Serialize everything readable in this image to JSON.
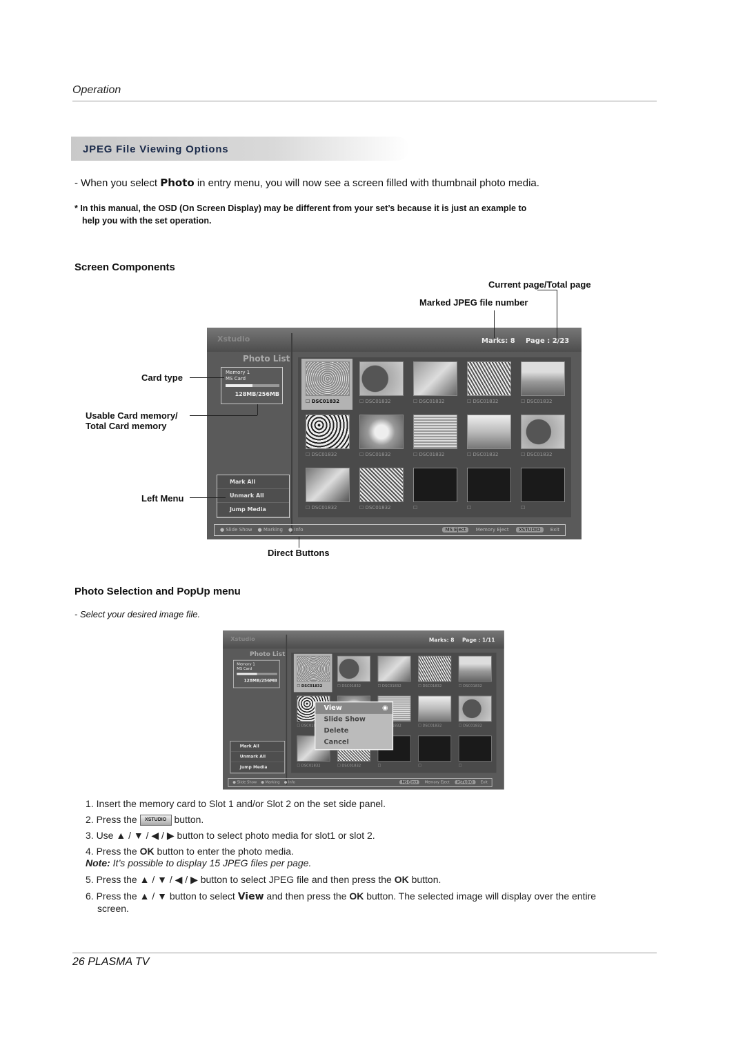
{
  "header": {
    "section": "Operation"
  },
  "section_title": "JPEG File Viewing Options",
  "intro": {
    "prefix": "- When you select ",
    "bold": "Photo",
    "suffix": " in entry menu, you will now see a screen filled with thumbnail photo media."
  },
  "note_line1": "* In this manual, the OSD (On Screen Display) may be different from your set’s because it is just an example to",
  "note_line2": "help you with the set operation.",
  "screen_components": {
    "title": "Screen Components",
    "callouts": {
      "current_page": "Current page/Total page",
      "marked": "Marked JPEG file number",
      "card_type": "Card type",
      "usable1": "Usable Card memory/",
      "usable2": "Total Card memory",
      "left_menu": "Left Menu",
      "direct": "Direct Buttons"
    }
  },
  "screen1": {
    "title": "Xstudio",
    "marks": "Marks: 8",
    "page": "Page : 2/23",
    "photo_list": "Photo List",
    "memory": "Memory 1",
    "card": "MS Card",
    "size": "128MB/256MB",
    "memory_used": 0.5,
    "left_menu": [
      "Mark All",
      "Unmark All",
      "Jump Media"
    ],
    "files": [
      "DSC01832",
      "DSC01832",
      "DSC01832",
      "DSC01832",
      "DSC01832",
      "DSC01832",
      "DSC01832",
      "DSC01832",
      "DSC01832",
      "DSC01832",
      "DSC01832",
      "DSC01832",
      "",
      "",
      ""
    ],
    "bottom": {
      "slide": "Slide Show",
      "marking": "Marking",
      "info": "Info",
      "eject_key": "MS Eject",
      "eject": "Memory Eject",
      "exit_key": "XSTUDIO",
      "exit": "Exit"
    }
  },
  "screen2": {
    "marks": "Marks: 8",
    "page": "Page : 1/11",
    "popup": [
      "View",
      "Slide Show",
      "Delete",
      "Cancel"
    ]
  },
  "popup_section": {
    "title": "Photo Selection and PopUp menu",
    "hint": "- Select your desired image file."
  },
  "steps": {
    "s1": "1. Insert the memory card to Slot 1 and/or Slot  2 on the set side panel.",
    "s2a": "2. Press the ",
    "s2key": "XSTUDIO",
    "s2b": " button.",
    "s3": "3. Use ▲ / ▼ / ◀ / ▶ button to select photo media for slot1 or slot 2.",
    "s4a": "4. Press the ",
    "ok": "OK",
    "s4b": " button to enter the photo media.",
    "note_label": "Note:",
    "note": " It’s possible to display 15 JPEG files per page.",
    "s5a": "5. Press the ▲ / ▼ / ◀ / ▶ button to select JPEG file and then press the ",
    "s5b": " button.",
    "s6a": "6. Press the ▲ / ▼ button to select ",
    "view": "View",
    "s6b": " and then press the ",
    "s6c": " button. The selected image will display over the entire",
    "s6d": "screen."
  },
  "footer": "26  PLASMA TV"
}
